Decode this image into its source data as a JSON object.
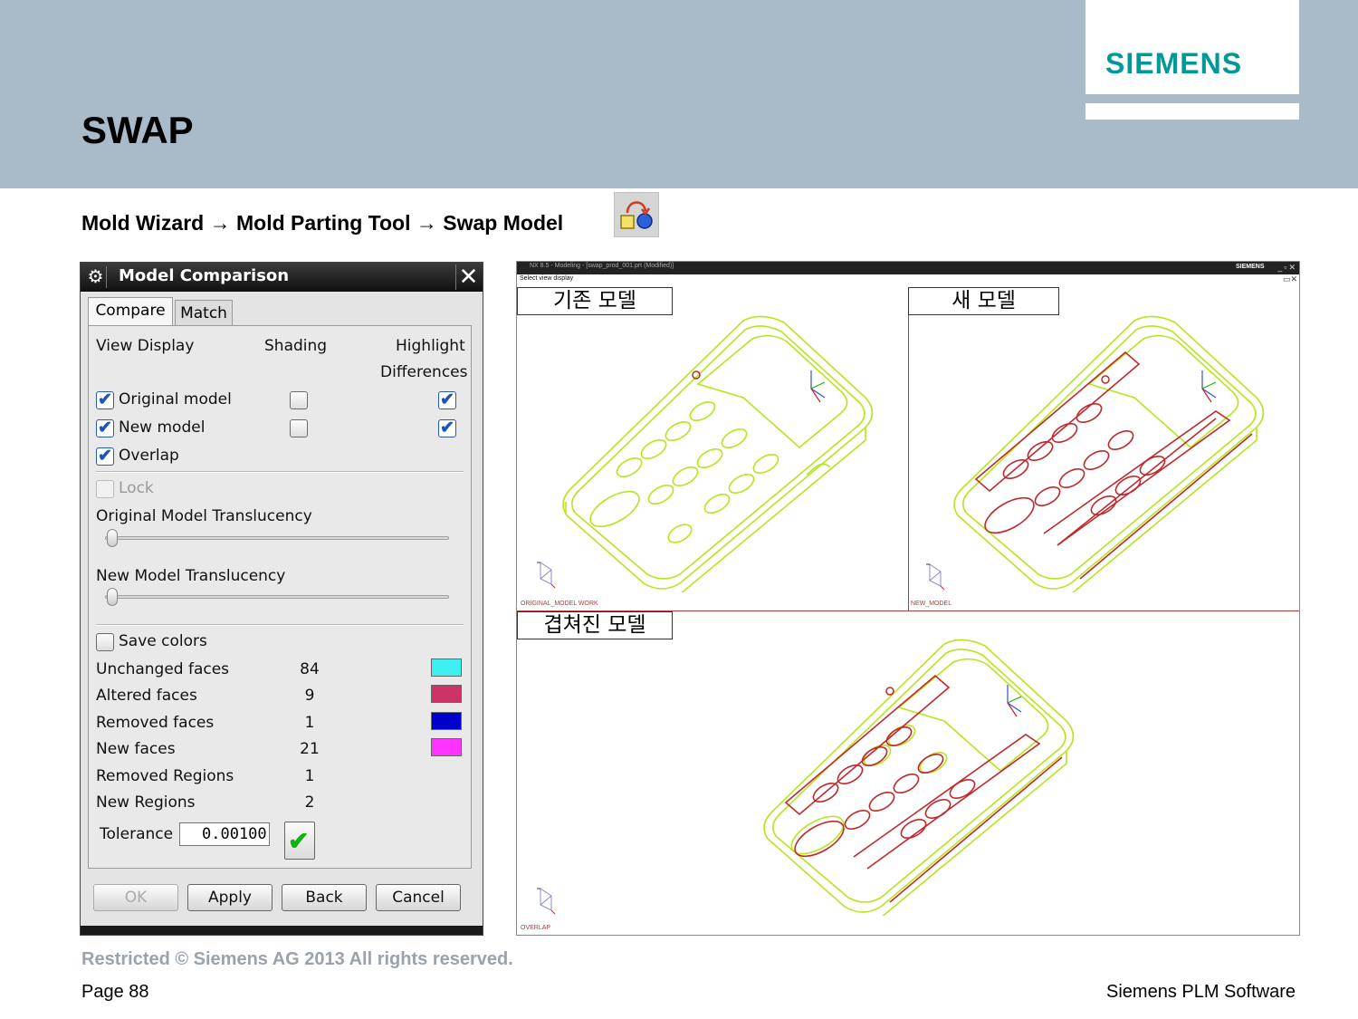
{
  "slide": {
    "title": "SWAP",
    "logo": "SIEMENS",
    "breadcrumb": "Mold Wizard → Mold Parting Tool → Swap Model",
    "footer_restricted": "Restricted © Siemens AG 2013 All rights reserved.",
    "footer_page": "Page 88",
    "footer_brand": "Siemens PLM Software"
  },
  "dialog": {
    "title": "Model Comparison",
    "tabs": [
      "Compare",
      "Match"
    ],
    "active_tab": "Compare",
    "headers": {
      "view_display": "View Display",
      "shading": "Shading",
      "highlight": "Highlight",
      "differences": "Differences"
    },
    "rows": [
      {
        "label": "Original model",
        "view": true,
        "shading": false,
        "highlight": true
      },
      {
        "label": "New model",
        "view": true,
        "shading": false,
        "highlight": true
      },
      {
        "label": "Overlap",
        "view": true
      }
    ],
    "lock_label": "Lock",
    "original_translucency_label": "Original Model Translucency",
    "original_translucency": 0,
    "new_translucency_label": "New Model Translucency",
    "new_translucency": 0,
    "save_colors_label": "Save colors",
    "stats": [
      {
        "label": "Unchanged faces",
        "value": "84",
        "color": "#40f0f0"
      },
      {
        "label": "Altered faces",
        "value": "9",
        "color": "#cc3366"
      },
      {
        "label": "Removed faces",
        "value": "1",
        "color": "#0000cc"
      },
      {
        "label": "New faces",
        "value": "21",
        "color": "#ff33ff"
      },
      {
        "label": "Removed Regions",
        "value": "1"
      },
      {
        "label": "New Regions",
        "value": "2"
      }
    ],
    "tolerance_label": "Tolerance",
    "tolerance_value": "0.00100",
    "buttons": {
      "ok": "OK",
      "apply": "Apply",
      "back": "Back",
      "cancel": "Cancel"
    }
  },
  "viewport": {
    "window_title": "NX 8.5 - Modeling - [swap_prod_001.prt (Modified)]",
    "brand": "SIEMENS",
    "status": "Select view display",
    "views": [
      {
        "caption": "기존 모델",
        "footer_label": "ORIGINAL_MODEL WORK"
      },
      {
        "caption": "새 모델",
        "footer_label": "NEW_MODEL"
      },
      {
        "caption": "겹쳐진 모델",
        "footer_label": "OVERLAP"
      }
    ],
    "colors": {
      "model_edge": "#b5e61d",
      "diff_edge": "#c0282c",
      "divider": "#b23a3a"
    }
  }
}
